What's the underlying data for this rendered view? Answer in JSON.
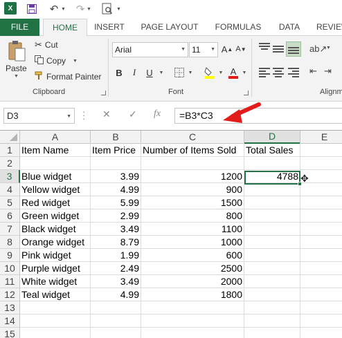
{
  "app": {
    "logo": "X"
  },
  "colors": {
    "accent": "#217346",
    "arrow": "#e21b1b"
  },
  "qat": {
    "icons": [
      "excel-logo-icon",
      "save-icon",
      "undo-icon",
      "redo-icon",
      "print-preview-icon"
    ]
  },
  "tabs": [
    "FILE",
    "HOME",
    "INSERT",
    "PAGE LAYOUT",
    "FORMULAS",
    "DATA",
    "REVIEW"
  ],
  "ribbon": {
    "clipboard": {
      "paste": "Paste",
      "cut": "Cut",
      "copy": "Copy",
      "format_painter": "Format Painter",
      "label": "Clipboard"
    },
    "font": {
      "name": "Arial",
      "size": "11",
      "bold": "B",
      "italic": "I",
      "underline": "U",
      "font_color_letter": "A",
      "label": "Font"
    },
    "alignment": {
      "label": "Alignm"
    }
  },
  "formula_bar": {
    "name_box": "D3",
    "formula": "=B3*C3",
    "cancel": "✕",
    "enter": "✓",
    "fx": "fx"
  },
  "columns": [
    "A",
    "B",
    "C",
    "D",
    "E"
  ],
  "rows": [
    "1",
    "2",
    "3",
    "4",
    "5",
    "6",
    "7",
    "8",
    "9",
    "10",
    "11",
    "12",
    "13",
    "14",
    "15"
  ],
  "selected": {
    "column": "D",
    "row": "3"
  },
  "sheet": {
    "headers": [
      "Item Name",
      "Item Price",
      "Number of Items Sold",
      "Total Sales"
    ],
    "data": [
      [
        "Blue widget",
        "3.99",
        "1200",
        "4788"
      ],
      [
        "Yellow widget",
        "4.99",
        "900",
        ""
      ],
      [
        "Red widget",
        "5.99",
        "1500",
        ""
      ],
      [
        "Green widget",
        "2.99",
        "800",
        ""
      ],
      [
        "Black widget",
        "3.49",
        "1100",
        ""
      ],
      [
        "Orange widget",
        "8.79",
        "1000",
        ""
      ],
      [
        "Pink widget",
        "1.99",
        "600",
        ""
      ],
      [
        "Purple widget",
        "2.49",
        "2500",
        ""
      ],
      [
        "White widget",
        "3.49",
        "2000",
        ""
      ],
      [
        "Teal widget",
        "4.99",
        "1800",
        ""
      ]
    ]
  }
}
